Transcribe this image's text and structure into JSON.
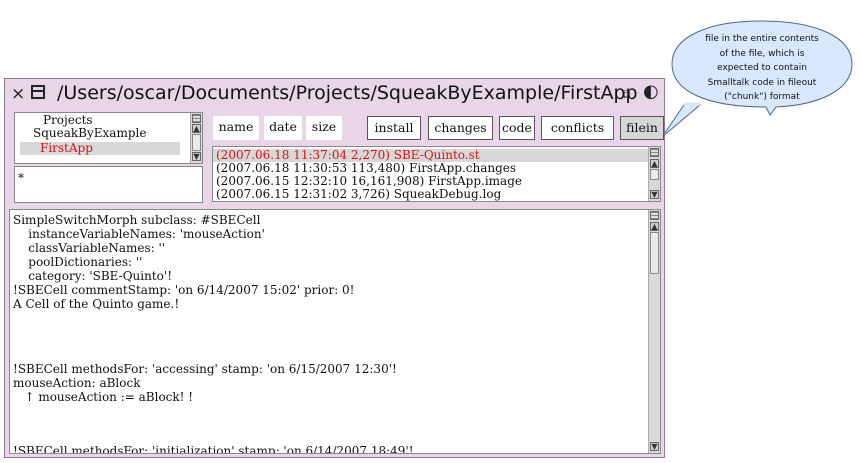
{
  "window": {
    "title": "/Users/oscar/Documents/Projects/SqueakByExample/FirstApp",
    "close_glyph": "×",
    "collapse_glyph": "⧉",
    "expand_glyph": "◐"
  },
  "projects": {
    "items": [
      "Projects",
      "SqueakByExample",
      "FirstApp"
    ],
    "selected": "FirstApp",
    "filter_text": "*"
  },
  "toolbar": {
    "buttons": [
      "name",
      "date",
      "size",
      "install",
      "changes",
      "code",
      "conflicts",
      "filein"
    ],
    "active": "filein"
  },
  "files": {
    "rows": [
      "(2007.06.18 11:37:04 2,270) SBE-Quinto.st",
      "(2007.06.18 11:30:53 113,480) FirstApp.changes",
      "(2007.06.15 12:32:10 16,161,908) FirstApp.image",
      "(2007.06.15 12:31:02 3,726) SqueakDebug.log"
    ],
    "selected_index": 0
  },
  "code": {
    "lines": [
      "SimpleSwitchMorph subclass: #SBECell",
      "    instanceVariableNames: 'mouseAction'",
      "    classVariableNames: ''",
      "    poolDictionaries: ''",
      "    category: 'SBE-Quinto'!",
      "!SBECell commentStamp: 'on 6/14/2007 15:02' prior: 0!",
      "A Cell of the Quinto game.!",
      "",
      "",
      "!SBECell methodsFor: 'accessing' stamp: 'on 6/15/2007 12:30'!",
      "mouseAction: aBlock",
      "   ↑ mouseAction := aBlock! !",
      "",
      "",
      "!SBECell methodsFor: 'initialization' stamp: 'on 6/14/2007 18:49'!"
    ]
  },
  "callout": {
    "text": "file in the entire contents of the file, which is expected to contain Smalltalk code in fileout (\"chunk\") format",
    "lines": [
      "file in the entire contents",
      "of the file, which is",
      "expected to contain",
      "Smalltalk code in fileout",
      "(\"chunk\") format"
    ]
  },
  "colors": {
    "window_bg": "#e8d6e8",
    "selected_text": "#e01010",
    "callout_fill": "#d9e8ff"
  }
}
